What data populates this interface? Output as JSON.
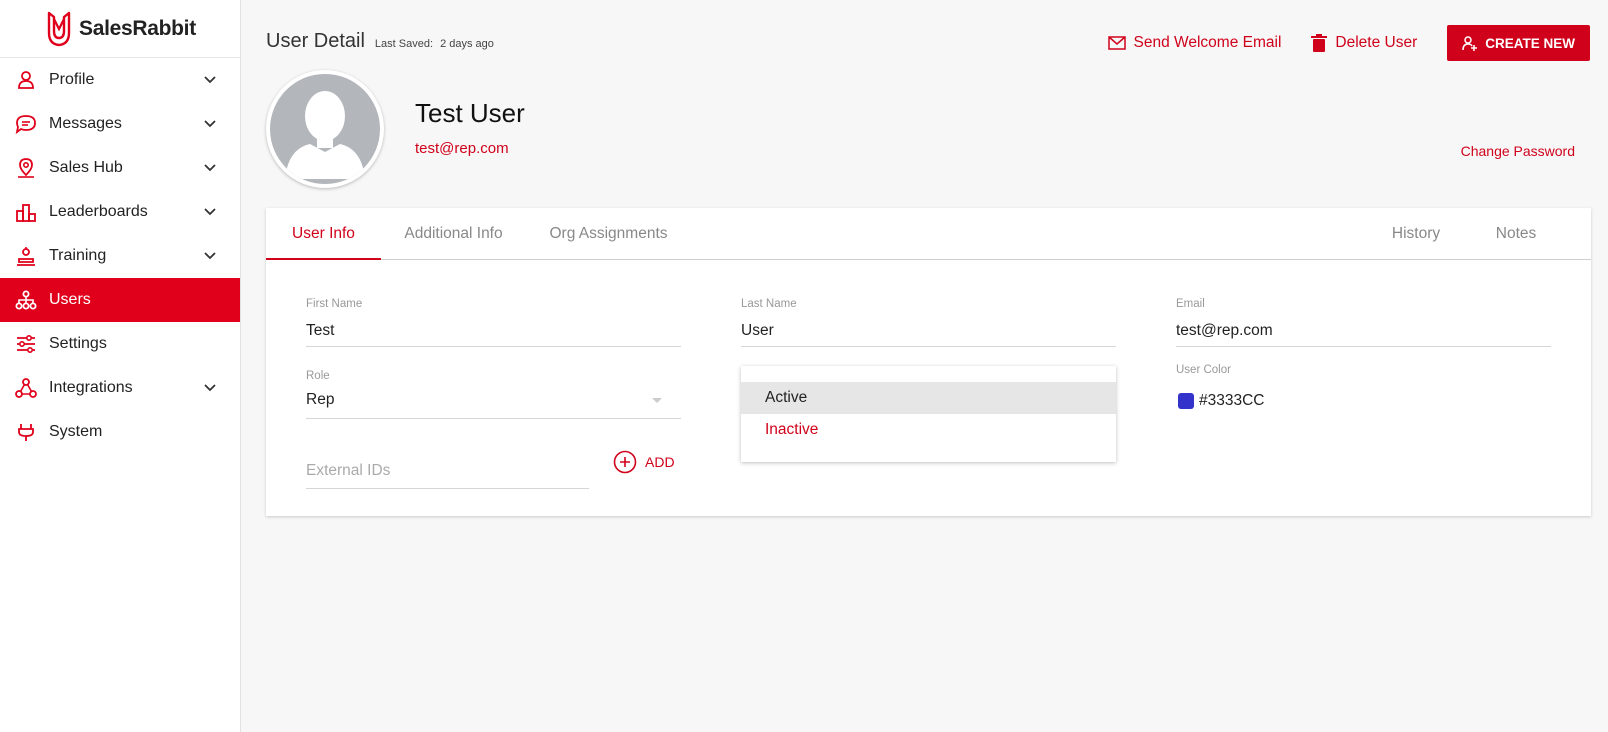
{
  "app": {
    "brand": "SalesRabbit",
    "accent": "#d0021b"
  },
  "sidebar": {
    "items": [
      {
        "label": "Profile",
        "icon": "person-icon",
        "expandable": true
      },
      {
        "label": "Messages",
        "icon": "chat-icon",
        "expandable": true
      },
      {
        "label": "Sales Hub",
        "icon": "map-pin-icon",
        "expandable": true
      },
      {
        "label": "Leaderboards",
        "icon": "podium-icon",
        "expandable": true
      },
      {
        "label": "Training",
        "icon": "training-icon",
        "expandable": true
      },
      {
        "label": "Users",
        "icon": "org-tree-icon",
        "expandable": false,
        "active": true
      },
      {
        "label": "Settings",
        "icon": "sliders-icon",
        "expandable": false
      },
      {
        "label": "Integrations",
        "icon": "integrations-icon",
        "expandable": true
      },
      {
        "label": "System",
        "icon": "plug-icon",
        "expandable": false
      }
    ]
  },
  "header": {
    "title": "User Detail",
    "last_saved_label": "Last Saved:",
    "last_saved_value": "2 days ago",
    "send_welcome_label": "Send Welcome Email",
    "delete_label": "Delete User",
    "create_label": "CREATE NEW"
  },
  "user": {
    "name": "Test User",
    "email": "test@rep.com",
    "change_password_label": "Change Password"
  },
  "tabs": {
    "left": [
      "User Info",
      "Additional Info",
      "Org Assignments"
    ],
    "right": [
      "History",
      "Notes"
    ],
    "active": "User Info"
  },
  "form": {
    "first_name": {
      "label": "First Name",
      "value": "Test"
    },
    "last_name": {
      "label": "Last Name",
      "value": "User"
    },
    "email": {
      "label": "Email",
      "value": "test@rep.com"
    },
    "role": {
      "label": "Role",
      "value": "Rep"
    },
    "user_color": {
      "label": "User Color",
      "value": "#3333CC",
      "swatch": "#3333CC"
    },
    "external_ids": {
      "placeholder": "External IDs",
      "add_label": "ADD"
    },
    "status_options": [
      "Active",
      "Inactive"
    ],
    "status_selected": "Active"
  }
}
